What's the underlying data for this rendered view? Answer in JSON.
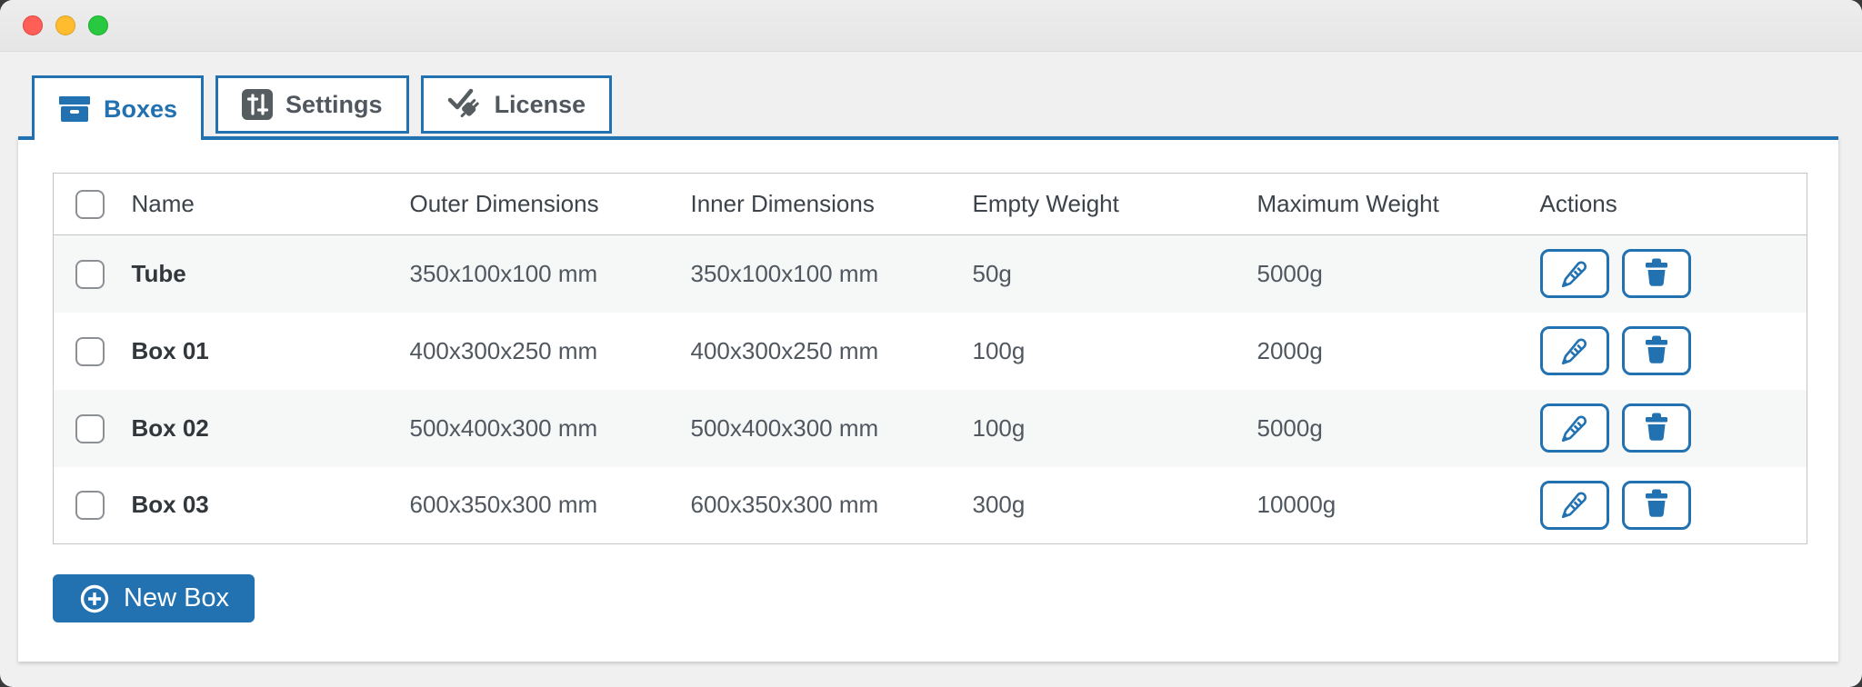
{
  "window": {
    "controls": [
      {
        "name": "close-button",
        "color": "#ff5f57"
      },
      {
        "name": "minimize-button",
        "color": "#febc2e"
      },
      {
        "name": "zoom-button",
        "color": "#28c840"
      }
    ]
  },
  "tabs": [
    {
      "label": "Boxes",
      "icon": "boxes-icon",
      "active": true
    },
    {
      "label": "Settings",
      "icon": "settings-icon",
      "active": false
    },
    {
      "label": "License",
      "icon": "license-icon",
      "active": false
    }
  ],
  "table": {
    "columns": {
      "select": "",
      "name": "Name",
      "outer": "Outer Dimensions",
      "inner": "Inner Dimensions",
      "empty": "Empty Weight",
      "max": "Maximum Weight",
      "actions": "Actions"
    },
    "rows": [
      {
        "name": "Tube",
        "outer": "350x100x100 mm",
        "inner": "350x100x100 mm",
        "empty": "50g",
        "max": "5000g"
      },
      {
        "name": "Box 01",
        "outer": "400x300x250 mm",
        "inner": "400x300x250 mm",
        "empty": "100g",
        "max": "2000g"
      },
      {
        "name": "Box 02",
        "outer": "500x400x300 mm",
        "inner": "500x400x300 mm",
        "empty": "100g",
        "max": "5000g"
      },
      {
        "name": "Box 03",
        "outer": "600x350x300 mm",
        "inner": "600x350x300 mm",
        "empty": "300g",
        "max": "10000g"
      }
    ],
    "row_actions": [
      {
        "action": "edit",
        "icon": "pencil-icon"
      },
      {
        "action": "delete",
        "icon": "trash-icon"
      }
    ]
  },
  "buttons": {
    "new_box": {
      "label": "New Box",
      "icon": "plus-circle-icon"
    }
  },
  "colors": {
    "accent_blue": "#2271b1",
    "page_background": "#f0f0f1",
    "titlebar": "#ececec",
    "table_border": "#c3c4c7",
    "row_stripe": "#f6f7f7",
    "header_text": "#3c434a",
    "cell_text": "#50575e",
    "checkbox_border": "#8c8f94"
  }
}
